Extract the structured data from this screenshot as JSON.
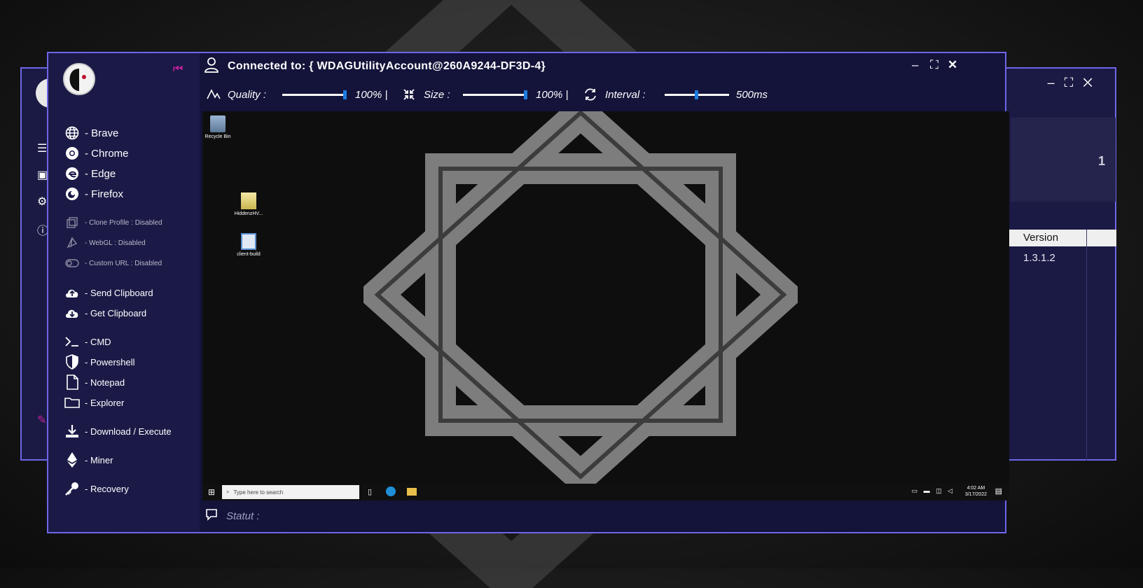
{
  "window": {
    "title": "Connected to: { WDAGUtilityAccount@260A9244-DF3D-4}"
  },
  "toolbar": {
    "quality_label": "Quality :",
    "quality_value": "100% |",
    "quality_level": 1.0,
    "size_label": "Size :",
    "size_value": "100% |",
    "size_level": 1.0,
    "interval_label": "Interval :",
    "interval_value": "500ms",
    "interval_level": 0.5
  },
  "sidebar": {
    "browsers": [
      {
        "label": "- Brave",
        "icon": "globe-icon"
      },
      {
        "label": "- Chrome",
        "icon": "chrome-icon"
      },
      {
        "label": "- Edge",
        "icon": "edge-icon"
      },
      {
        "label": "- Firefox",
        "icon": "firefox-icon"
      }
    ],
    "options": [
      {
        "label": "- Clone Profile : Disabled",
        "icon": "clone-icon"
      },
      {
        "label": "- WebGL : Disabled",
        "icon": "webgl-icon"
      },
      {
        "label": "- Custom URL : Disabled",
        "icon": "toggle-icon"
      }
    ],
    "clipboard": [
      {
        "label": "- Send Clipboard",
        "icon": "cloud-upload-icon"
      },
      {
        "label": "- Get Clipboard",
        "icon": "cloud-download-icon"
      }
    ],
    "tools": [
      {
        "label": "- CMD",
        "icon": "terminal-icon"
      },
      {
        "label": "- Powershell",
        "icon": "shield-icon"
      },
      {
        "label": "- Notepad",
        "icon": "file-icon"
      },
      {
        "label": "- Explorer",
        "icon": "folder-icon"
      }
    ],
    "download_execute": "- Download / Execute",
    "miner": "- Miner",
    "recovery": "- Recovery"
  },
  "remote_desktop": {
    "icons": [
      {
        "label": "Recycle Bin"
      },
      {
        "label": "HiddenzHV..."
      },
      {
        "label": "client-build"
      }
    ],
    "search_placeholder": "Type here to search",
    "clock_time": "4:02 AM",
    "clock_date": "3/17/2022"
  },
  "status": {
    "label": "Statut :"
  },
  "back_window": {
    "count": "1",
    "column_header": "Version",
    "version_value": "1.3.1.2"
  }
}
